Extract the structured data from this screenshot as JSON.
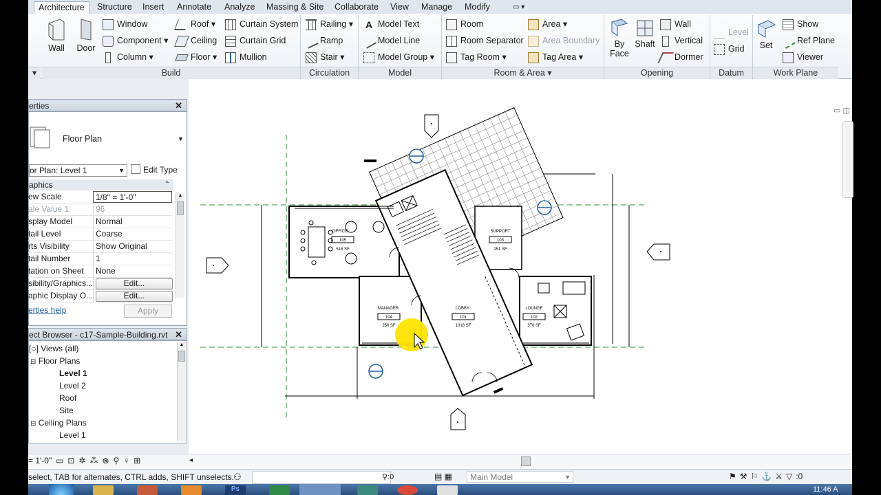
{
  "tabs": [
    "Architecture",
    "Structure",
    "Insert",
    "Annotate",
    "Analyze",
    "Massing & Site",
    "Collaborate",
    "View",
    "Manage",
    "Modify"
  ],
  "ribbon": {
    "build": {
      "wall": "Wall",
      "door": "Door",
      "window": "Window",
      "component": "Component",
      "column": "Column",
      "roof": "Roof",
      "ceiling": "Ceiling",
      "floor": "Floor",
      "curtain_system": "Curtain System",
      "curtain_grid": "Curtain Grid",
      "mullion": "Mullion",
      "label": "Build"
    },
    "circulation": {
      "railing": "Railing",
      "ramp": "Ramp",
      "stair": "Stair",
      "label": "Circulation"
    },
    "model": {
      "model_text": "Model Text",
      "model_line": "Model Line",
      "model_group": "Model Group",
      "label": "Model"
    },
    "room_area": {
      "room": "Room",
      "room_separator": "Room Separator",
      "tag_room": "Tag Room",
      "area": "Area",
      "area_boundary": "Area Boundary",
      "tag_area": "Tag Area",
      "label": "Room & Area"
    },
    "opening": {
      "by_face_1": "By",
      "by_face_2": "Face",
      "shaft": "Shaft",
      "wall": "Wall",
      "vertical": "Vertical",
      "dormer": "Dormer",
      "label": "Opening"
    },
    "datum": {
      "level": "Level",
      "grid": "Grid",
      "label": "Datum"
    },
    "work_plane": {
      "set": "Set",
      "show": "Show",
      "ref_plane": "Ref Plane",
      "viewer": "Viewer",
      "label": "Work Plane"
    }
  },
  "properties": {
    "title": "erties",
    "type_name": "Floor Plan",
    "selector": "or Plan: Level 1",
    "edit_type": "Edit Type",
    "group": "aphics",
    "rows": [
      {
        "k": "ew Scale",
        "v": "1/8\" = 1'-0\""
      },
      {
        "k": "ale Value  1:",
        "v": "96"
      },
      {
        "k": "splay Model",
        "v": "Normal"
      },
      {
        "k": "tail Level",
        "v": "Coarse"
      },
      {
        "k": "rts Visibility",
        "v": "Show Original"
      },
      {
        "k": "tail Number",
        "v": "1"
      },
      {
        "k": "tation on Sheet",
        "v": "None"
      },
      {
        "k": "sibility/Graphics...",
        "v": "Edit..."
      },
      {
        "k": "aphic Display O...",
        "v": "Edit..."
      }
    ],
    "help": "erties help",
    "apply": "Apply"
  },
  "browser": {
    "title": "ect Browser - c17-Sample-Building.rvt",
    "items": [
      "Views (all)",
      "Floor Plans",
      "Level 1",
      "Level 2",
      "Roof",
      "Site",
      "Ceiling Plans",
      "Level 1"
    ]
  },
  "plan": {
    "rooms": [
      {
        "name": "OFFICE",
        "num": "105",
        "area": "516 SF"
      },
      {
        "name": "SUPPORT",
        "num": "103",
        "area": "151 SF"
      },
      {
        "name": "MANAGER",
        "num": "104",
        "area": "256 SF"
      },
      {
        "name": "LOBBY",
        "num": "101",
        "area": "1018 SF"
      },
      {
        "name": "LOUNGE",
        "num": "102",
        "area": "370 SF"
      }
    ]
  },
  "viewbar": {
    "scale": "1'-0\""
  },
  "status": {
    "hint": "select, TAB for alternates, CTRL adds, SHIFT unselects.",
    "count": ":0",
    "model": "Main Model",
    "filter": ":0"
  },
  "taskbar": {
    "time": "11:46 A"
  },
  "colors": {
    "accent": "#2b5d9b",
    "tagblue": "#1f5fa8",
    "highlight": "#ffe400"
  }
}
